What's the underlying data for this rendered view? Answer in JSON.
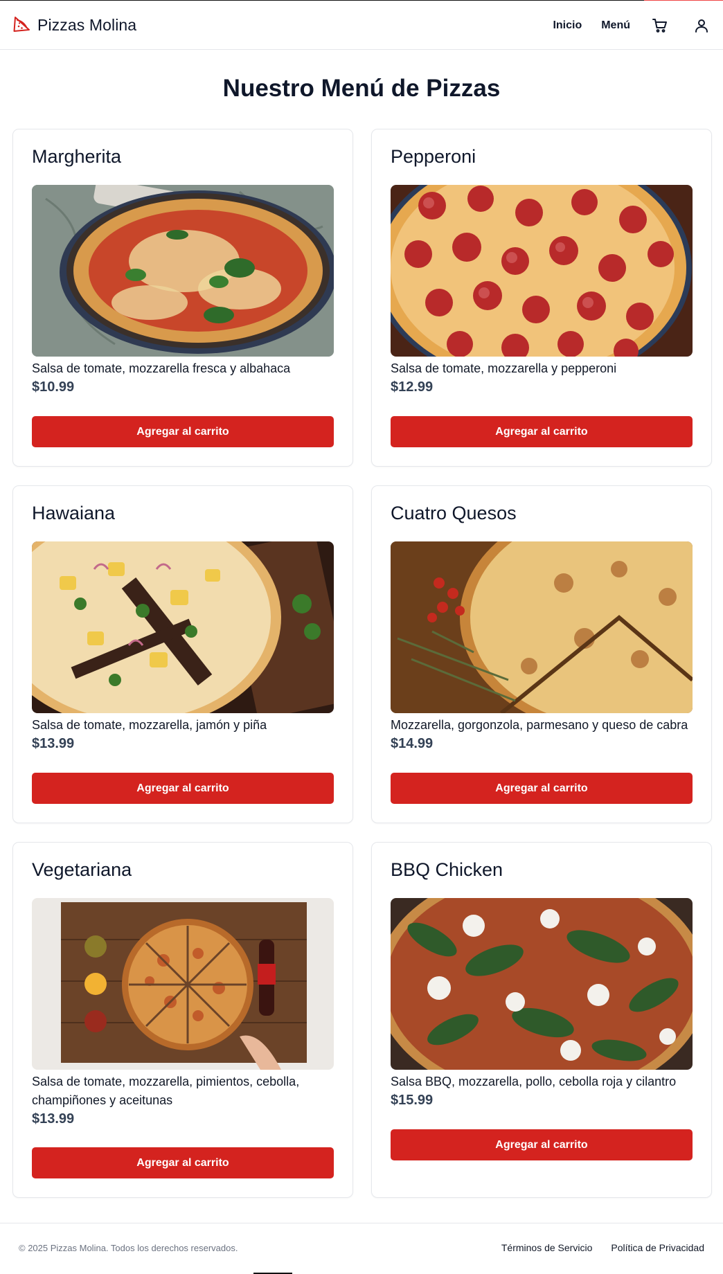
{
  "brand": {
    "name": "Pizzas Molina",
    "accent": "#d4231f",
    "icon": "pizza-slice-icon"
  },
  "nav": {
    "links": [
      "Inicio",
      "Menú"
    ],
    "cart_icon": "cart-icon",
    "user_icon": "user-icon"
  },
  "page": {
    "title": "Nuestro Menú de Pizzas"
  },
  "products": [
    {
      "name": "Margherita",
      "description": "Salsa de tomate, mozzarella fresca y albahaca",
      "price": "$10.99",
      "button": "Agregar al carrito"
    },
    {
      "name": "Pepperoni",
      "description": "Salsa de tomate, mozzarella y pepperoni",
      "price": "$12.99",
      "button": "Agregar al carrito"
    },
    {
      "name": "Hawaiana",
      "description": "Salsa de tomate, mozzarella, jamón y piña",
      "price": "$13.99",
      "button": "Agregar al carrito"
    },
    {
      "name": "Cuatro Quesos",
      "description": "Mozzarella, gorgonzola, parmesano y queso de cabra",
      "price": "$14.99",
      "button": "Agregar al carrito"
    },
    {
      "name": "Vegetariana",
      "description": "Salsa de tomate, mozzarella, pimientos, cebolla, champiñones y aceitunas",
      "price": "$13.99",
      "button": "Agregar al carrito"
    },
    {
      "name": "BBQ Chicken",
      "description": "Salsa BBQ, mozzarella, pollo, cebolla roja y cilantro",
      "price": "$15.99",
      "button": "Agregar al carrito"
    }
  ],
  "footer": {
    "copyright": "© 2025 Pizzas Molina. Todos los derechos reservados.",
    "links": [
      "Términos de Servicio",
      "Política de Privacidad"
    ]
  }
}
